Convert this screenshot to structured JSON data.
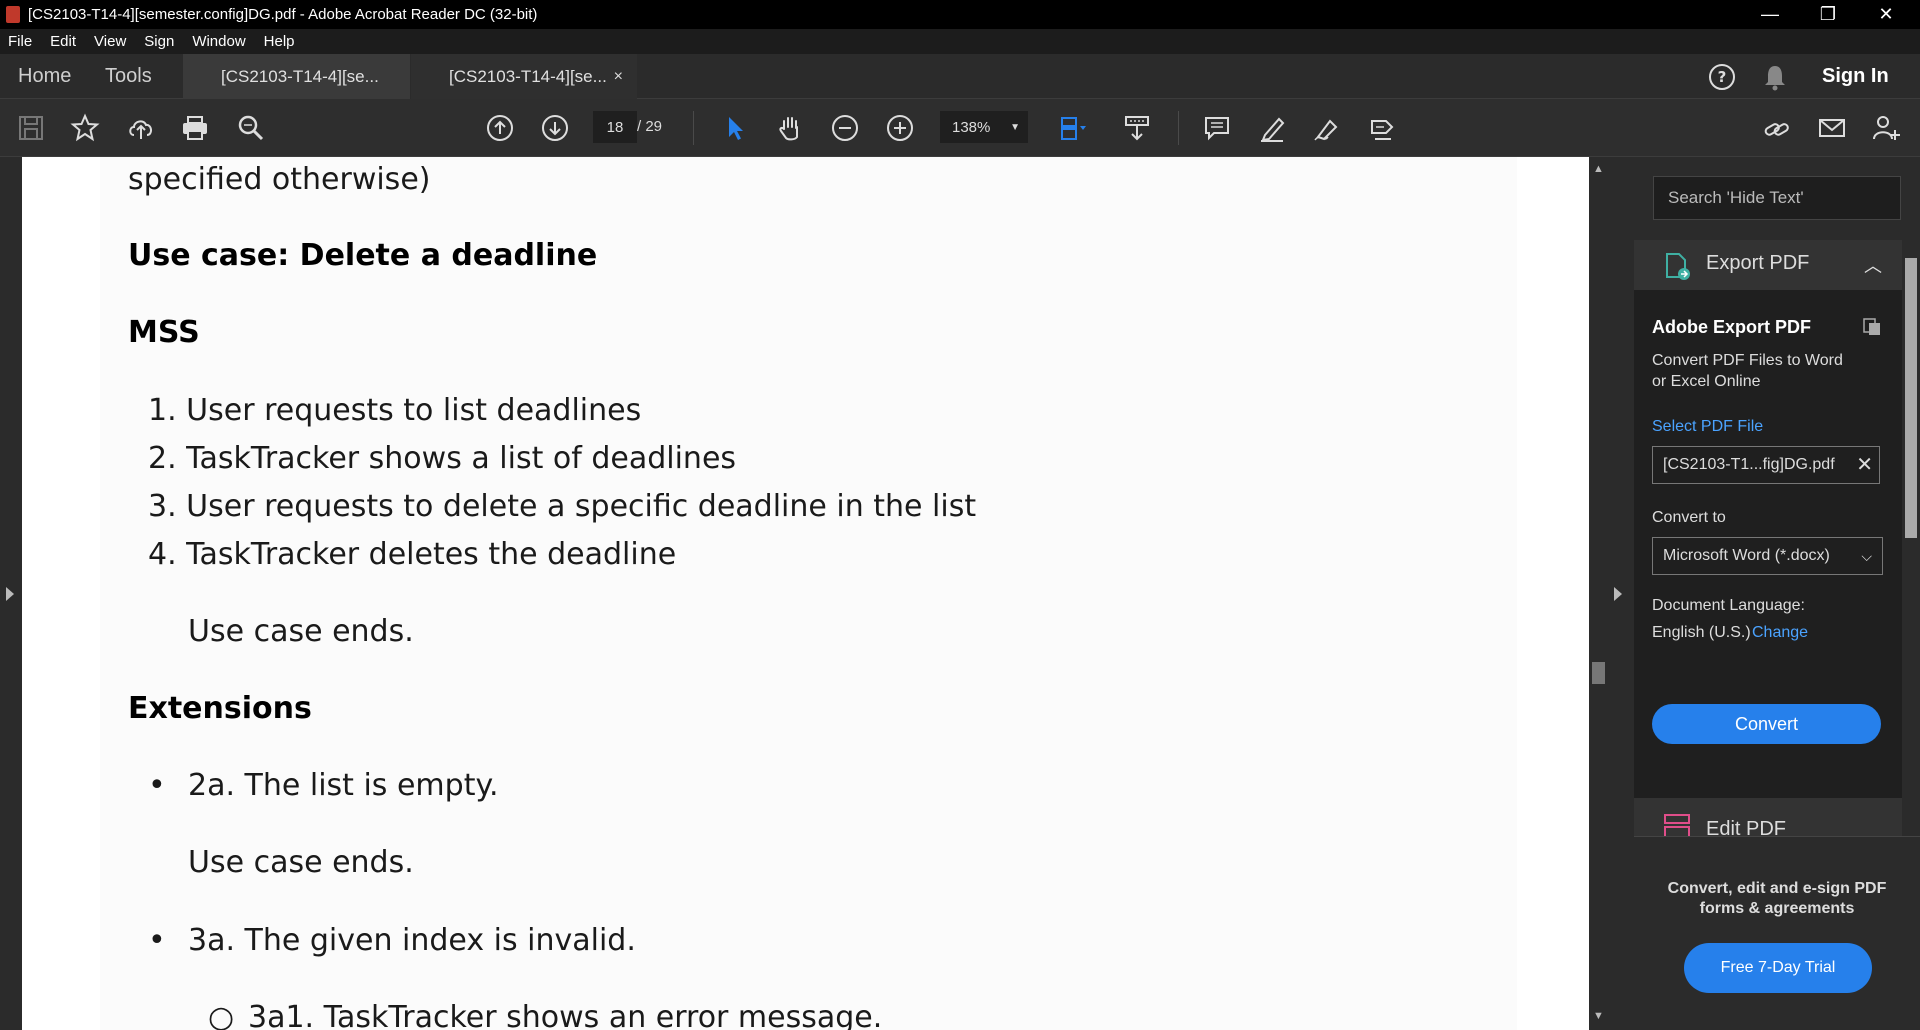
{
  "window": {
    "title": "[CS2103-T14-4][semester.config]DG.pdf - Adobe Acrobat Reader DC (32-bit)",
    "minimize": "—",
    "restore": "❐",
    "close": "✕"
  },
  "menu": [
    "File",
    "Edit",
    "View",
    "Sign",
    "Window",
    "Help"
  ],
  "tabs": {
    "home": "Home",
    "tools": "Tools",
    "doc1": "[CS2103-T14-4][se...",
    "doc2": "[CS2103-T14-4][se...",
    "close": "×",
    "sign_in": "Sign In"
  },
  "toolbar": {
    "page_current": "18",
    "page_total": "/ 29",
    "zoom": "138%"
  },
  "document": {
    "line1": "specified otherwise)",
    "heading1": "Use case: Delete a deadline",
    "heading2": "MSS",
    "steps": [
      "1. User requests to list deadlines",
      "2. TaskTracker shows a list of deadlines",
      "3. User requests to delete a specific deadline in the list",
      "4. TaskTracker deletes the deadline"
    ],
    "ends1": "Use case ends.",
    "heading3": "Extensions",
    "ext1": "2a. The list is empty.",
    "ends2": "Use case ends.",
    "ext2": "3a. The given index is invalid.",
    "ext2a": "3a1. TaskTracker shows an error message."
  },
  "panel": {
    "search_placeholder": "Search 'Hide Text'",
    "export_header": "Export PDF",
    "card_title": "Adobe Export PDF",
    "card_desc1": "Convert PDF Files to Word",
    "card_desc2": "or Excel Online",
    "select_label": "Select PDF File",
    "file_name": "[CS2103-T1...fig]DG.pdf",
    "convert_to": "Convert to",
    "format": "Microsoft Word (*.docx)",
    "doc_lang": "Document Language:",
    "lang": "English (U.S.)",
    "change": "Change",
    "convert_btn": "Convert",
    "edit_pdf": "Edit PDF",
    "promo1": "Convert, edit and e-sign PDF",
    "promo2": "forms & agreements",
    "trial_btn": "Free 7-Day Trial"
  },
  "colors": {
    "accent": "#2680eb",
    "link": "#4ba3ff",
    "edit_icon": "#e04e8a",
    "export_icon": "#3fb0a3"
  }
}
